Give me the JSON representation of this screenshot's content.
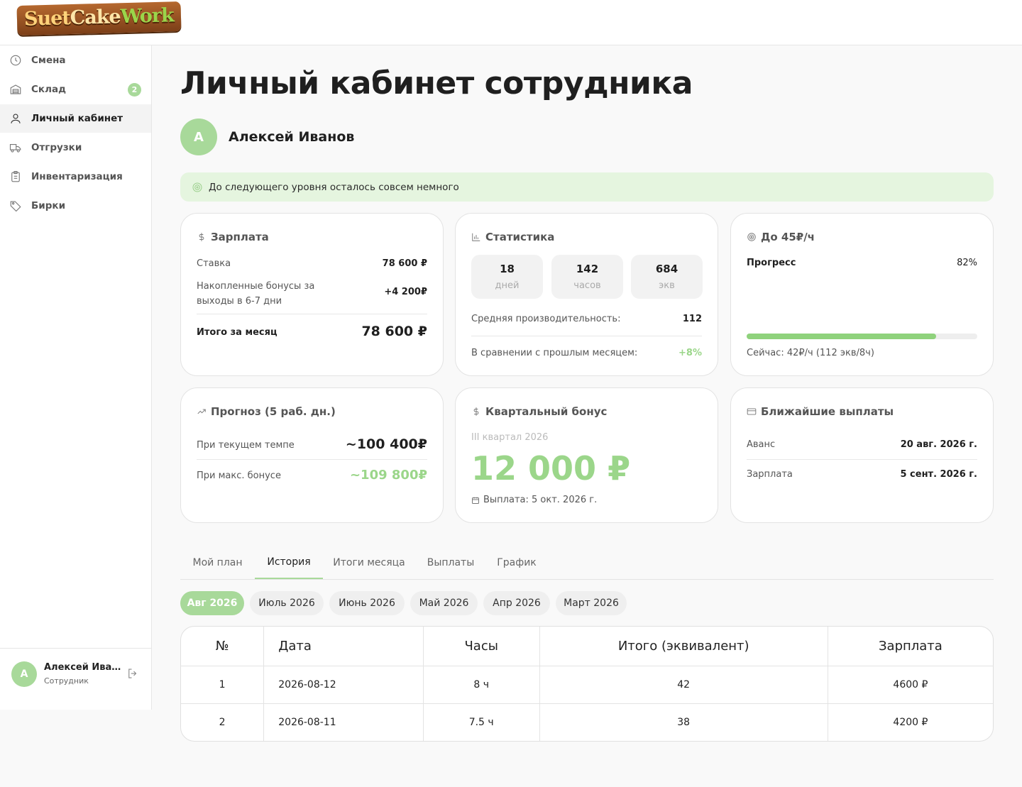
{
  "brand": {
    "part1": "Suet",
    "part2": "Cake",
    "part3": "Work"
  },
  "sidebar": {
    "items": [
      {
        "label": "Смена",
        "icon": "clock-icon"
      },
      {
        "label": "Склад",
        "icon": "warehouse-icon",
        "badge": "2"
      },
      {
        "label": "Личный кабинет",
        "icon": "user-icon",
        "active": true
      },
      {
        "label": "Отгрузки",
        "icon": "truck-icon"
      },
      {
        "label": "Инвентаризация",
        "icon": "clipboard-icon"
      },
      {
        "label": "Бирки",
        "icon": "tag-icon"
      }
    ],
    "user": {
      "initial": "А",
      "name": "Алексей Иван...",
      "role": "Сотрудник"
    }
  },
  "page": {
    "title": "Личный кабинет сотрудника",
    "avatar_initial": "А",
    "user_name": "Алексей Иванов",
    "alert": "До следующего уровня осталось совсем немного"
  },
  "colors": {
    "accent": "#a8d99a",
    "accent_text": "#9bd68a",
    "alert_bg": "#e5f5df"
  },
  "cards": {
    "salary": {
      "title": "Зарплата",
      "rate_label": "Ставка",
      "rate_value": "78 600 ₽",
      "bonus_label_1": "Накопленные бонусы за",
      "bonus_label_2": "выходы в 6-7 дни",
      "bonus_value": "+4 200₽",
      "total_label": "Итого за месяц",
      "total_value": "78 600 ₽"
    },
    "stats": {
      "title": "Статистика",
      "boxes": [
        {
          "num": "18",
          "unit": "дней"
        },
        {
          "num": "142",
          "unit": "часов"
        },
        {
          "num": "684",
          "unit": "экв"
        }
      ],
      "avg_label": "Средняя производительность:",
      "avg_value": "112",
      "compare_label": "В сравнении с прошлым месяцем:",
      "compare_value": "+8%"
    },
    "target": {
      "title": "До 45₽/ч",
      "progress_label": "Прогресс",
      "progress_value": "82%",
      "progress_fraction": 0.82,
      "now": "Сейчас: 42₽/ч (112 экв/8ч)"
    },
    "forecast": {
      "title": "Прогноз (5 раб. дн.)",
      "current_label": "При текущем темпе",
      "current_value": "~100 400₽",
      "max_label": "При макс. бонусе",
      "max_value": "~109 800₽"
    },
    "quarter": {
      "title": "Квартальный бонус",
      "period": "III квартал 2026",
      "amount": "12 000 ₽",
      "payout": "Выплата: 5 окт. 2026 г."
    },
    "payouts": {
      "title": "Ближайшие выплаты",
      "rows": [
        {
          "label": "Аванс",
          "value": "20 авг. 2026 г."
        },
        {
          "label": "Зарплата",
          "value": "5 сент. 2026 г."
        }
      ]
    }
  },
  "tabs": [
    "Мой план",
    "История",
    "Итоги месяца",
    "Выплаты",
    "График"
  ],
  "active_tab": "История",
  "months": [
    "Авг 2026",
    "Июль 2026",
    "Июнь 2026",
    "Май 2026",
    "Апр 2026",
    "Март 2026"
  ],
  "table": {
    "headers": [
      "№",
      "Дата",
      "Часы",
      "Итого (эквивалент)",
      "Зарплата"
    ],
    "rows": [
      [
        "1",
        "2026-08-12",
        "8 ч",
        "42",
        "4600 ₽"
      ],
      [
        "2",
        "2026-08-11",
        "7.5 ч",
        "38",
        "4200 ₽"
      ]
    ]
  }
}
